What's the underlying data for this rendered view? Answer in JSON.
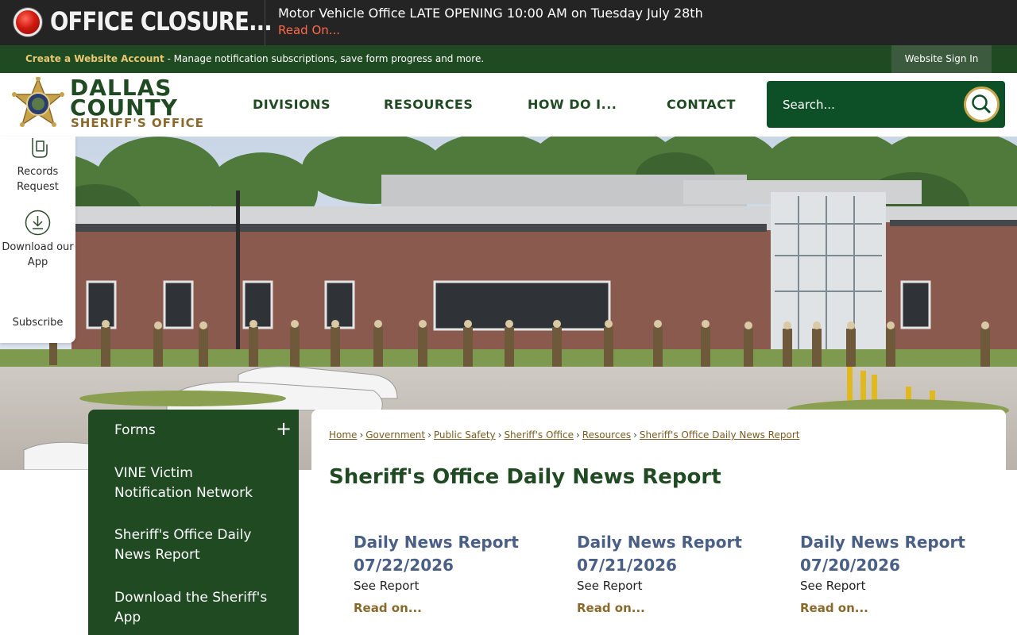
{
  "alert": {
    "title": "OFFICE CLOSURE...",
    "message": "Motor Vehicle Office LATE OPENING 10:00 AM on Tuesday July 28th",
    "link": "Read On..."
  },
  "account_bar": {
    "create_link": "Create a Website Account",
    "description": " - Manage notification subscriptions, save form progress and more.",
    "signin": "Website Sign In"
  },
  "logo": {
    "line1": "DALLAS",
    "line2": "COUNTY",
    "line3": "SHERIFF'S OFFICE"
  },
  "nav": [
    "DIVISIONS",
    "RESOURCES",
    "HOW DO I...",
    "CONTACT"
  ],
  "search": {
    "placeholder": "Search..."
  },
  "quick_links": [
    {
      "label": "Records Request",
      "icon": "records-request-icon"
    },
    {
      "label": "Download our App",
      "icon": "download-icon"
    },
    {
      "label": "Subscribe",
      "icon": "subscribe-icon"
    }
  ],
  "side_nav": {
    "items": [
      "Forms",
      "VINE Victim Notification Network",
      "Sheriff's Office Daily News Report",
      "Download the Sheriff's App"
    ]
  },
  "breadcrumb": [
    "Home",
    "Government",
    "Public Safety",
    "Sheriff's Office",
    "Resources",
    "Sheriff's Office Daily News Report"
  ],
  "page_title": "Sheriff's Office Daily News Report",
  "news": [
    {
      "title": "Daily News Report 07/22/2026",
      "desc": "See Report",
      "link": "Read on..."
    },
    {
      "title": "Daily News Report 07/21/2026",
      "desc": "See Report",
      "link": "Read on..."
    },
    {
      "title": "Daily News Report 07/20/2026",
      "desc": "See Report",
      "link": "Read on..."
    }
  ],
  "colors": {
    "alert_bg": "#242424",
    "brand_green": "#1f4a22",
    "gold": "#8a6a2c",
    "link_blue": "#4a5f86",
    "alert_red": "#ff6a4a"
  }
}
